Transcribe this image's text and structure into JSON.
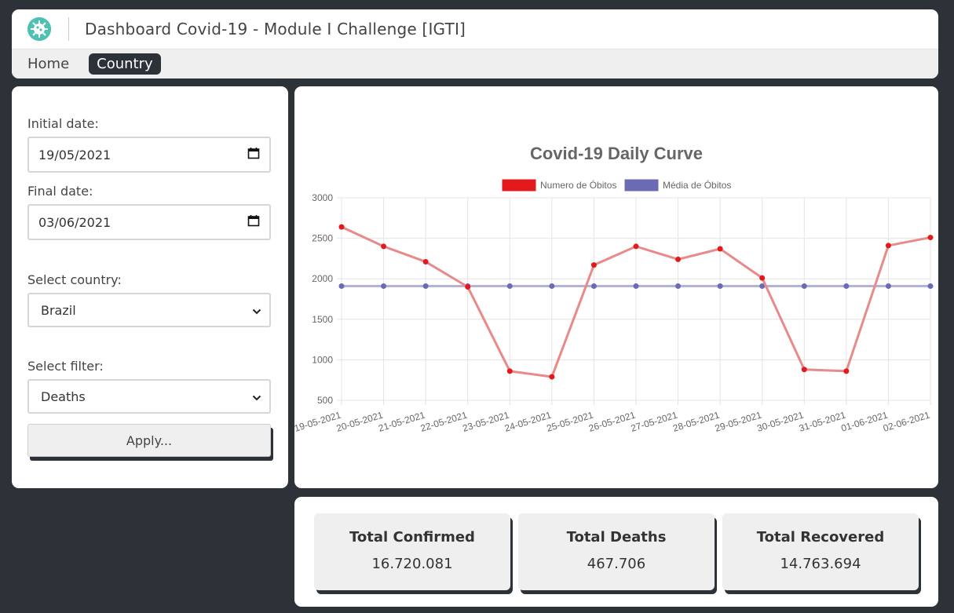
{
  "header": {
    "title": "Dashboard Covid-19 - Module I Challenge [IGTI]",
    "logo_icon": "virus-icon"
  },
  "nav": {
    "items": [
      {
        "label": "Home",
        "active": false
      },
      {
        "label": "Country",
        "active": true
      }
    ]
  },
  "filters": {
    "initial_date_label": "Initial date:",
    "initial_date_value": "19/05/2021",
    "final_date_label": "Final date:",
    "final_date_value": "03/06/2021",
    "country_label": "Select country:",
    "country_value": "Brazil",
    "filter_label": "Select filter:",
    "filter_value": "Deaths",
    "apply_label": "Apply..."
  },
  "chart_data": {
    "type": "line",
    "title": "Covid-19 Daily Curve",
    "categories": [
      "19-05-2021",
      "20-05-2021",
      "21-05-2021",
      "22-05-2021",
      "23-05-2021",
      "24-05-2021",
      "25-05-2021",
      "26-05-2021",
      "27-05-2021",
      "28-05-2021",
      "29-05-2021",
      "30-05-2021",
      "31-05-2021",
      "01-06-2021",
      "02-06-2021"
    ],
    "series": [
      {
        "name": "Numero de Óbitos",
        "color": "#e31a1c",
        "line_color": "#e88a8a",
        "values": [
          2640,
          2400,
          2210,
          1900,
          860,
          790,
          2170,
          2400,
          2240,
          2370,
          2010,
          880,
          860,
          2410,
          2510
        ]
      },
      {
        "name": "Média de Óbitos",
        "color": "#6b6bb3",
        "line_color": "#b3b3d6",
        "values": [
          1910,
          1910,
          1910,
          1910,
          1910,
          1910,
          1910,
          1910,
          1910,
          1910,
          1910,
          1910,
          1910,
          1910,
          1910
        ]
      }
    ],
    "ylim": [
      500,
      3000
    ],
    "yticks": [
      500,
      1000,
      1500,
      2000,
      2500,
      3000
    ],
    "grid": true,
    "legend": "top-center"
  },
  "stats": [
    {
      "title": "Total Confirmed",
      "value": "16.720.081"
    },
    {
      "title": "Total Deaths",
      "value": "467.706"
    },
    {
      "title": "Total Recovered",
      "value": "14.763.694"
    }
  ]
}
